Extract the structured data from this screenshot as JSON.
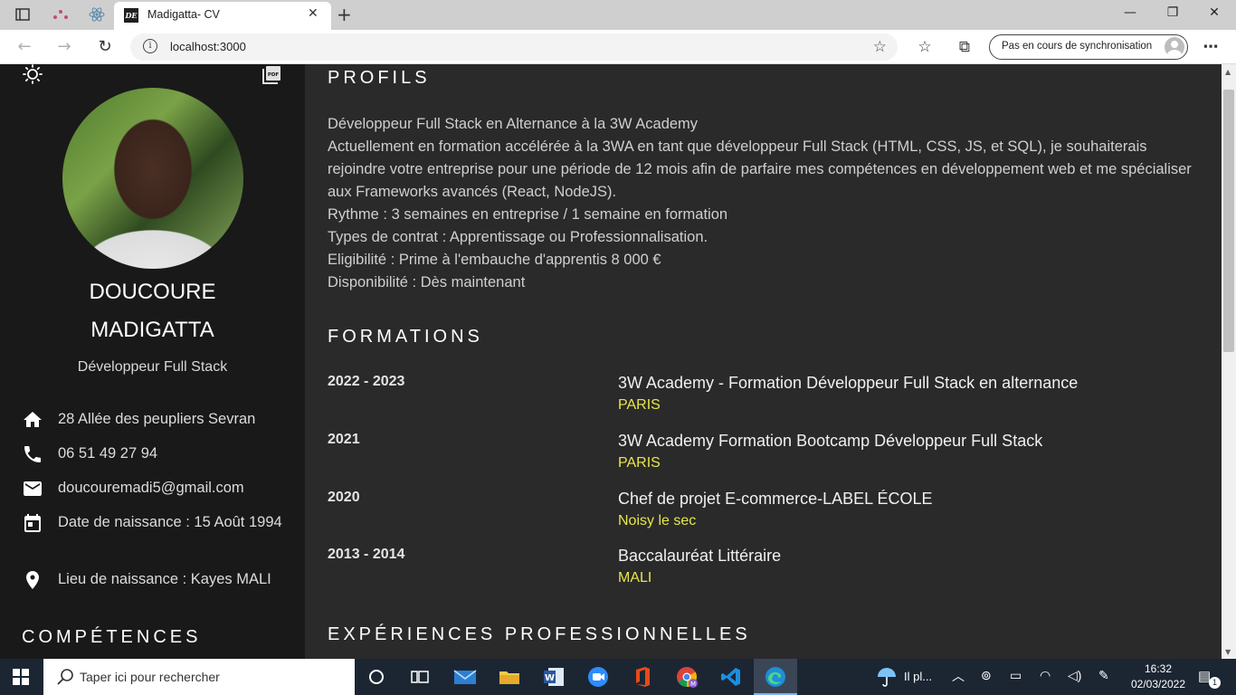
{
  "browser": {
    "tab_title": "Madigatta- CV",
    "favicon_text": "DE",
    "url": "localhost:3000",
    "sync_label": "Pas en cours de synchronisation"
  },
  "sidebar": {
    "first_name": "DOUCOURE",
    "last_name": "MADIGATTA",
    "role": "Développeur Full Stack",
    "contacts": [
      {
        "icon": "home-icon",
        "text": "28 Allée des peupliers Sevran"
      },
      {
        "icon": "phone-icon",
        "text": "06 51 49 27 94"
      },
      {
        "icon": "mail-icon",
        "text": "doucouremadi5@gmail.com"
      },
      {
        "icon": "calendar-icon",
        "text": "Date de naissance : 15 Août 1994"
      },
      {
        "icon": "location-pin-icon",
        "text": "Lieu de naissance : Kayes MALI"
      }
    ],
    "skills_title": "COMPÉTENCES"
  },
  "main": {
    "profile_title": "PROFILS",
    "profile_lines": [
      "Développeur Full Stack en Alternance à la 3W Academy",
      "Actuellement en formation accélérée à la 3WA en tant que développeur Full Stack (HTML, CSS, JS, et SQL), je souhaiterais rejoindre votre entreprise pour une période de 12 mois afin de parfaire mes compétences en développement web et me spécialiser aux Frameworks avancés (React, NodeJS).",
      "Rythme : 3 semaines en entreprise / 1 semaine en formation",
      "Types de contrat : Apprentissage ou Professionnalisation.",
      "Eligibilité : Prime à l'embauche d'apprentis 8 000 €",
      "Disponibilité : Dès maintenant"
    ],
    "education_title": "FORMATIONS",
    "education": [
      {
        "years": "2022 - 2023",
        "title": "3W Academy - Formation Développeur Full Stack en alternance",
        "place": "PARIS"
      },
      {
        "years": "2021",
        "title": "3W Academy Formation Bootcamp Développeur Full Stack",
        "place": "PARIS"
      },
      {
        "years": "2020",
        "title": "Chef de projet E-commerce-LABEL ÉCOLE",
        "place": "Noisy le sec"
      },
      {
        "years": "2013 - 2014",
        "title": "Baccalauréat Littéraire",
        "place": "MALI"
      }
    ],
    "experience_title": "EXPÉRIENCES PROFESSIONNELLES"
  },
  "taskbar": {
    "search_placeholder": "Taper ici pour rechercher",
    "weather_text": "Il pl...",
    "time": "16:32",
    "date": "02/03/2022",
    "notification_count": "1"
  },
  "colors": {
    "sidebar_bg": "#191919",
    "main_bg": "#2a2a2a",
    "accent_yellow": "#e6e64c"
  }
}
